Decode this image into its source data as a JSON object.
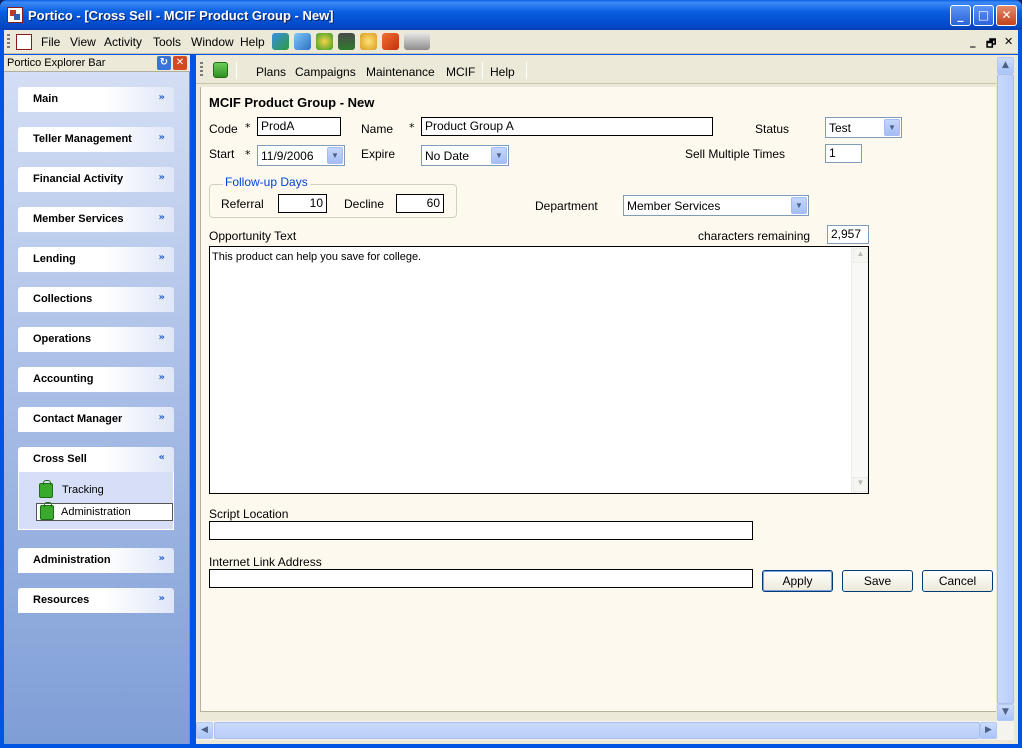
{
  "window": {
    "title": "Portico - [Cross Sell - MCIF Product Group - New]",
    "controls": {
      "minimize": "_",
      "maximize": "□",
      "close": "✕"
    }
  },
  "menubar": {
    "items": [
      "File",
      "View",
      "Activity",
      "Tools",
      "Window",
      "Help"
    ],
    "mdi_controls": {
      "minimize": "_",
      "restore": "🗗",
      "close": "✕"
    }
  },
  "explorer": {
    "title": "Portico Explorer Bar",
    "sections": [
      {
        "label": "Main",
        "chevron": "»",
        "expanded": false
      },
      {
        "label": "Teller Management",
        "chevron": "»",
        "expanded": false
      },
      {
        "label": "Financial Activity",
        "chevron": "»",
        "expanded": false
      },
      {
        "label": "Member Services",
        "chevron": "»",
        "expanded": false
      },
      {
        "label": "Lending",
        "chevron": "»",
        "expanded": false
      },
      {
        "label": "Collections",
        "chevron": "»",
        "expanded": false
      },
      {
        "label": "Operations",
        "chevron": "»",
        "expanded": false
      },
      {
        "label": "Accounting",
        "chevron": "»",
        "expanded": false
      },
      {
        "label": "Contact Manager",
        "chevron": "»",
        "expanded": false
      },
      {
        "label": "Cross Sell",
        "chevron": "«",
        "expanded": true,
        "items": [
          {
            "label": "Tracking",
            "selected": false
          },
          {
            "label": "Administration",
            "selected": true
          }
        ]
      },
      {
        "label": "Administration",
        "chevron": "»",
        "expanded": false
      },
      {
        "label": "Resources",
        "chevron": "»",
        "expanded": false
      }
    ]
  },
  "child_toolbar": {
    "items": [
      "Plans",
      "Campaigns",
      "Maintenance",
      "MCIF",
      "Help"
    ]
  },
  "form": {
    "heading": "MCIF Product Group - New",
    "required_mark": "*",
    "code": {
      "label": "Code",
      "value": "ProdA"
    },
    "name": {
      "label": "Name",
      "value": "Product Group A"
    },
    "status": {
      "label": "Status",
      "value": "Test"
    },
    "start": {
      "label": "Start",
      "value": "11/9/2006"
    },
    "expire": {
      "label": "Expire",
      "value": "No Date"
    },
    "sell_multiple": {
      "label": "Sell Multiple Times",
      "value": "1"
    },
    "followup": {
      "title": "Follow-up Days",
      "referral": {
        "label": "Referral",
        "value": "10"
      },
      "decline": {
        "label": "Decline",
        "value": "60"
      }
    },
    "department": {
      "label": "Department",
      "value": "Member Services"
    },
    "opportunity": {
      "label": "Opportunity Text",
      "remaining_label": "characters remaining",
      "remaining_value": "2,957",
      "text": "This product can help you save for college."
    },
    "script_location": {
      "label": "Script Location",
      "value": ""
    },
    "internet_link": {
      "label": "Internet Link Address",
      "value": ""
    },
    "buttons": {
      "apply": "Apply",
      "save": "Save",
      "cancel": "Cancel"
    }
  },
  "scroll_glyphs": {
    "up": "▲",
    "down": "▼",
    "left": "◀",
    "right": "▶",
    "grip": "≡"
  },
  "colors": {
    "title_blue": "#0054e3",
    "form_bg": "#fdf9ee",
    "group_title": "#0046d5"
  }
}
